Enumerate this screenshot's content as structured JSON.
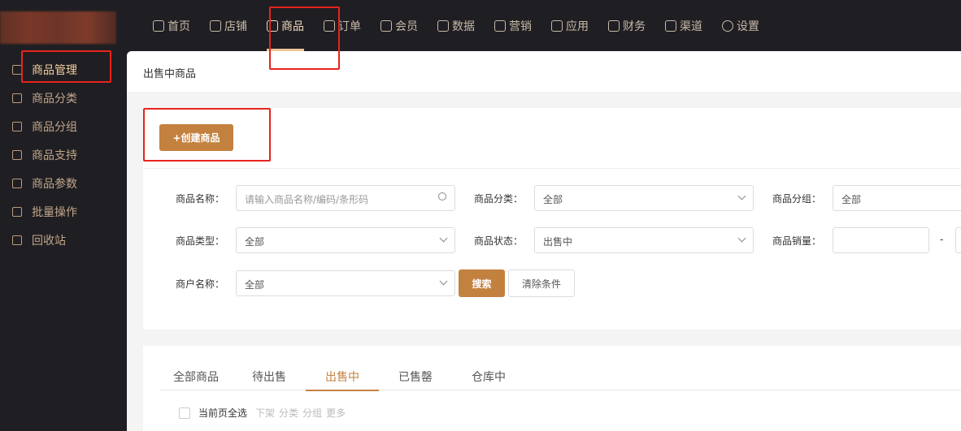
{
  "topnav": [
    {
      "label": "首页",
      "icon": "home-icon"
    },
    {
      "label": "店铺",
      "icon": "store-icon"
    },
    {
      "label": "商品",
      "icon": "goods-icon",
      "active": true
    },
    {
      "label": "订单",
      "icon": "order-icon"
    },
    {
      "label": "会员",
      "icon": "user-icon"
    },
    {
      "label": "数据",
      "icon": "chart-icon"
    },
    {
      "label": "营销",
      "icon": "tag-icon"
    },
    {
      "label": "应用",
      "icon": "app-icon"
    },
    {
      "label": "财务",
      "icon": "yen-icon"
    },
    {
      "label": "渠道",
      "icon": "channel-icon"
    },
    {
      "label": "设置",
      "icon": "gear-icon"
    }
  ],
  "sidebar": [
    {
      "label": "商品管理",
      "active": true
    },
    {
      "label": "商品分类"
    },
    {
      "label": "商品分组"
    },
    {
      "label": "商品支持"
    },
    {
      "label": "商品参数"
    },
    {
      "label": "批量操作"
    },
    {
      "label": "回收站"
    }
  ],
  "breadcrumb": "出售中商品",
  "create_button": "+创建商品",
  "filters": {
    "name_label": "商品名称：",
    "name_placeholder": "请输入商品名称/编码/条形码",
    "category_label": "商品分类：",
    "category_value": "全部",
    "group_label": "商品分组：",
    "group_value": "全部",
    "type_label": "商品类型：",
    "type_value": "全部",
    "status_label": "商品状态：",
    "status_value": "出售中",
    "sales_label": "商品销量：",
    "sales_sep": "-",
    "merchant_label": "商户名称：",
    "merchant_value": "全部",
    "search_button": "搜索",
    "clear_button": "清除条件"
  },
  "tabs": [
    "全部商品",
    "待出售",
    "出售中",
    "已售罄",
    "仓库中"
  ],
  "bulk": {
    "select_all": "当前页全选",
    "actions": [
      "下架",
      "分类",
      "分组",
      "更多"
    ]
  }
}
